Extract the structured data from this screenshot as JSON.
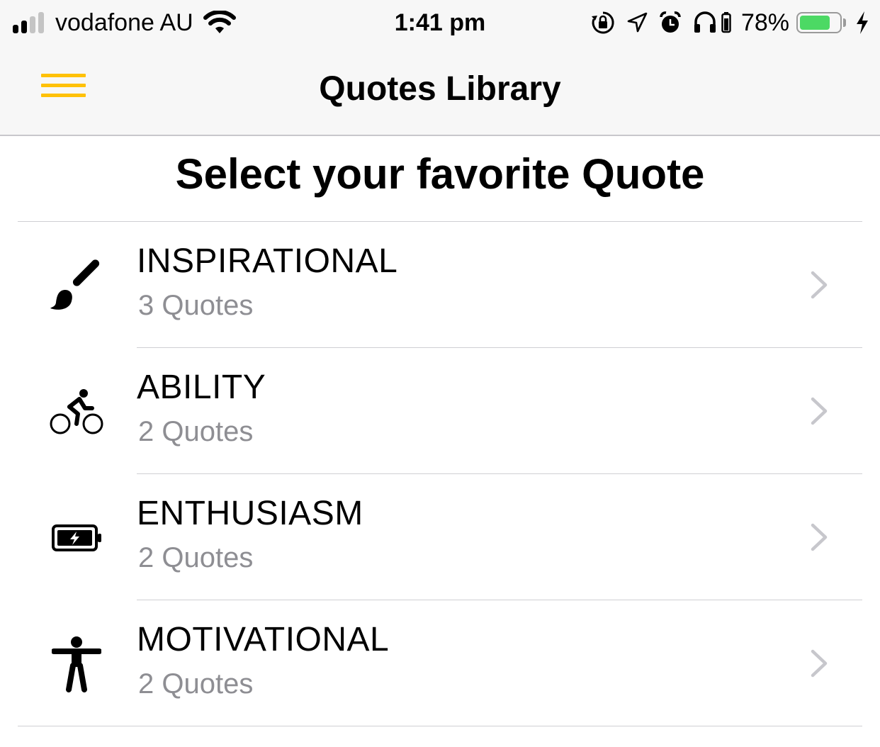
{
  "status_bar": {
    "carrier": "vodafone AU",
    "time": "1:41 pm",
    "battery_percent": "78%",
    "battery_level": 0.78,
    "signal_bars_filled": 2,
    "signal_bars_total": 4,
    "icons": [
      "wifi-icon",
      "orientation-lock-icon",
      "location-icon",
      "alarm-icon",
      "headphones-icon",
      "battery-icon",
      "charging-icon"
    ]
  },
  "nav": {
    "title": "Quotes Library",
    "menu_icon": "hamburger-menu-icon"
  },
  "page": {
    "heading": "Select your favorite Quote"
  },
  "categories": [
    {
      "title": "INSPIRATIONAL",
      "subtitle": "3 Quotes",
      "icon": "paintbrush-icon"
    },
    {
      "title": "ABILITY",
      "subtitle": "2 Quotes",
      "icon": "bicycle-rider-icon"
    },
    {
      "title": "ENTHUSIASM",
      "subtitle": "2 Quotes",
      "icon": "battery-charging-icon"
    },
    {
      "title": "MOTIVATIONAL",
      "subtitle": "2 Quotes",
      "icon": "person-standing-icon"
    }
  ],
  "colors": {
    "accent": "#FFC107",
    "bar_background": "#F7F7F7",
    "battery_green": "#4CD964",
    "subtitle_gray": "#8E8E93",
    "chevron_gray": "#C7C7CC",
    "divider": "#CFCFD3"
  }
}
